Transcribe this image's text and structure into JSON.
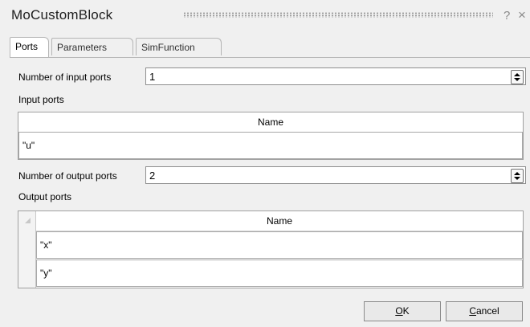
{
  "window": {
    "title": "MoCustomBlock",
    "help_glyph": "?",
    "close_glyph": "×"
  },
  "tabs": [
    {
      "label": "Ports",
      "active": true
    },
    {
      "label": "Parameters",
      "active": false
    },
    {
      "label": "SimFunction",
      "active": false
    }
  ],
  "inputs": {
    "count_label": "Number of input ports",
    "count_value": "1",
    "section_label": "Input ports",
    "column_header": "Name",
    "rows": [
      "\"u\""
    ]
  },
  "outputs": {
    "count_label": "Number of output ports",
    "count_value": "2",
    "section_label": "Output ports",
    "column_header": "Name",
    "rows": [
      "\"x\"",
      "\"y\""
    ]
  },
  "buttons": {
    "ok_mnemonic": "O",
    "ok_rest": "K",
    "cancel_mnemonic": "C",
    "cancel_rest": "ancel"
  },
  "icons": {
    "help": "help-icon",
    "close": "close-icon",
    "spin_up": "chevron-up-icon",
    "spin_down": "chevron-down-icon"
  }
}
